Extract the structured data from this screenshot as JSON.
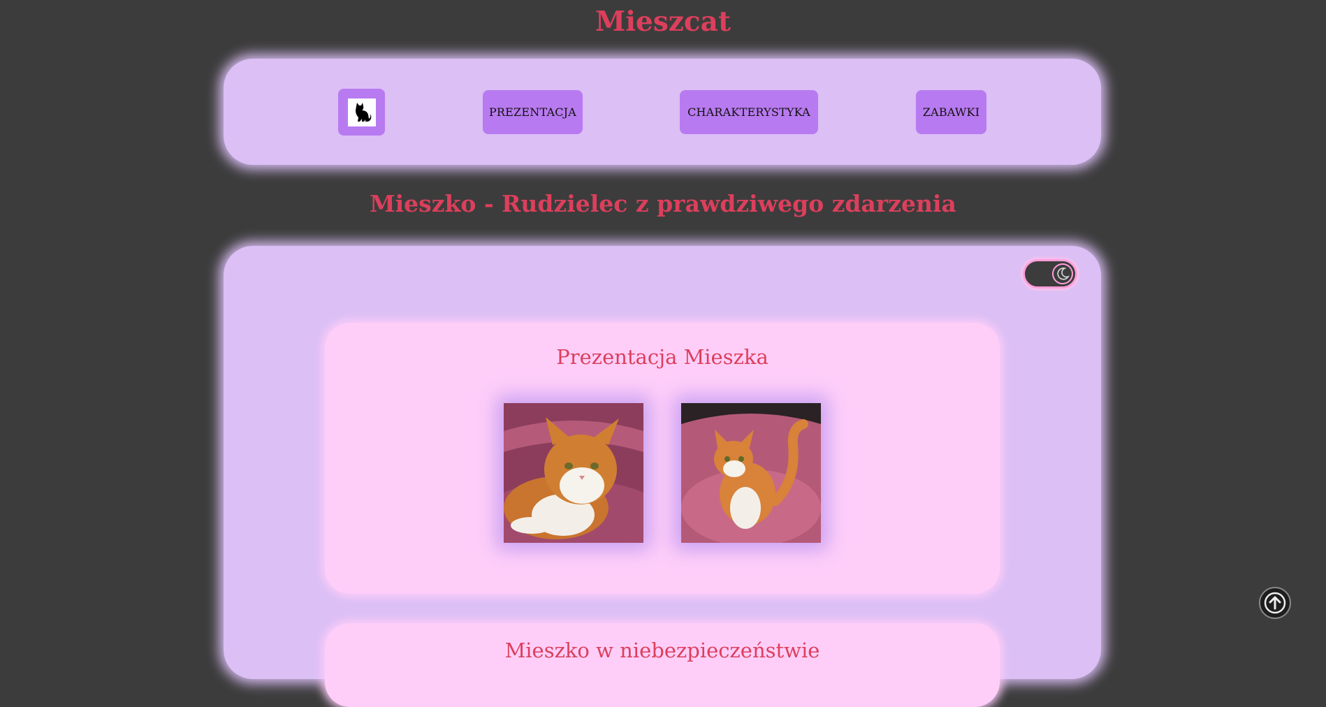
{
  "site": {
    "title": "Mieszcat"
  },
  "nav": {
    "logo_icon": "cat-silhouette-icon",
    "items": [
      {
        "label": "PREZENTACJA"
      },
      {
        "label": "CHARAKTERYSTYKA"
      },
      {
        "label": "ZABAWKI"
      }
    ]
  },
  "main": {
    "heading": "Mieszko - Rudzielec z prawdziwego zdarzenia",
    "theme_toggle_icon": "moon-icon",
    "sections": [
      {
        "title": "Prezentacja Mieszka",
        "photos": [
          "orange-white-cat-lying",
          "orange-white-cat-sitting"
        ]
      },
      {
        "title": "Mieszko w niebezpieczeństwie"
      }
    ]
  },
  "scroll_top_icon": "arrow-up-icon",
  "colors": {
    "background": "#3c3c3c",
    "accent_text": "#dc3f5c",
    "panel": "#dbbff5",
    "card": "#fecef9",
    "button": "#b87af0"
  }
}
